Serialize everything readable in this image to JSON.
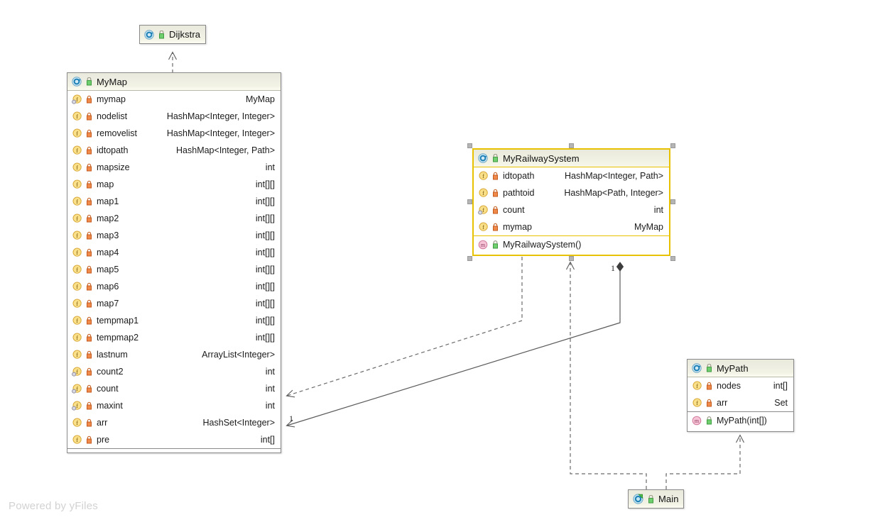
{
  "diagram": {
    "watermark": "Powered by yFiles",
    "classes": [
      {
        "id": "dijkstra",
        "name": "Dijkstra",
        "icon": "class-icon",
        "visibility_icon": "package-visibility-icon",
        "selected": false,
        "fields": [],
        "methods": []
      },
      {
        "id": "mymap",
        "name": "MyMap",
        "icon": "class-icon",
        "visibility_icon": "package-visibility-icon",
        "selected": false,
        "fields": [
          {
            "name": "mymap",
            "type": "MyMap",
            "icon": "field-static-icon",
            "lock": "private-lock-icon"
          },
          {
            "name": "nodelist",
            "type": "HashMap<Integer, Integer>",
            "icon": "field-icon",
            "lock": "private-lock-icon"
          },
          {
            "name": "removelist",
            "type": "HashMap<Integer, Integer>",
            "icon": "field-icon",
            "lock": "private-lock-icon"
          },
          {
            "name": "idtopath",
            "type": "HashMap<Integer, Path>",
            "icon": "field-icon",
            "lock": "private-lock-icon"
          },
          {
            "name": "mapsize",
            "type": "int",
            "icon": "field-icon",
            "lock": "private-lock-icon"
          },
          {
            "name": "map",
            "type": "int[][]",
            "icon": "field-icon",
            "lock": "private-lock-icon"
          },
          {
            "name": "map1",
            "type": "int[][]",
            "icon": "field-icon",
            "lock": "private-lock-icon"
          },
          {
            "name": "map2",
            "type": "int[][]",
            "icon": "field-icon",
            "lock": "private-lock-icon"
          },
          {
            "name": "map3",
            "type": "int[][]",
            "icon": "field-icon",
            "lock": "private-lock-icon"
          },
          {
            "name": "map4",
            "type": "int[][]",
            "icon": "field-icon",
            "lock": "private-lock-icon"
          },
          {
            "name": "map5",
            "type": "int[][]",
            "icon": "field-icon",
            "lock": "private-lock-icon"
          },
          {
            "name": "map6",
            "type": "int[][]",
            "icon": "field-icon",
            "lock": "private-lock-icon"
          },
          {
            "name": "map7",
            "type": "int[][]",
            "icon": "field-icon",
            "lock": "private-lock-icon"
          },
          {
            "name": "tempmap1",
            "type": "int[][]",
            "icon": "field-icon",
            "lock": "private-lock-icon"
          },
          {
            "name": "tempmap2",
            "type": "int[][]",
            "icon": "field-icon",
            "lock": "private-lock-icon"
          },
          {
            "name": "lastnum",
            "type": "ArrayList<Integer>",
            "icon": "field-icon",
            "lock": "private-lock-icon"
          },
          {
            "name": "count2",
            "type": "int",
            "icon": "field-static-icon",
            "lock": "private-lock-icon"
          },
          {
            "name": "count",
            "type": "int",
            "icon": "field-static-icon",
            "lock": "private-lock-icon"
          },
          {
            "name": "maxint",
            "type": "int",
            "icon": "field-static-icon",
            "lock": "private-lock-icon"
          },
          {
            "name": "arr",
            "type": "HashSet<Integer>",
            "icon": "field-icon",
            "lock": "private-lock-icon"
          },
          {
            "name": "pre",
            "type": "int[]",
            "icon": "field-icon",
            "lock": "private-lock-icon"
          }
        ],
        "methods": []
      },
      {
        "id": "myrailwaysystem",
        "name": "MyRailwaySystem",
        "icon": "class-icon",
        "visibility_icon": "package-visibility-icon",
        "selected": true,
        "fields": [
          {
            "name": "idtopath",
            "type": "HashMap<Integer, Path>",
            "icon": "field-icon",
            "lock": "private-lock-icon"
          },
          {
            "name": "pathtoid",
            "type": "HashMap<Path, Integer>",
            "icon": "field-icon",
            "lock": "private-lock-icon"
          },
          {
            "name": "count",
            "type": "int",
            "icon": "field-static-icon",
            "lock": "private-lock-icon"
          },
          {
            "name": "mymap",
            "type": "MyMap",
            "icon": "field-icon",
            "lock": "private-lock-icon"
          }
        ],
        "methods": [
          {
            "name": "MyRailwaySystem()",
            "icon": "method-icon",
            "lock": "package-visibility-icon"
          }
        ]
      },
      {
        "id": "mypath",
        "name": "MyPath",
        "icon": "class-icon",
        "visibility_icon": "package-visibility-icon",
        "selected": false,
        "fields": [
          {
            "name": "nodes",
            "type": "int[]",
            "icon": "field-icon",
            "lock": "private-lock-icon"
          },
          {
            "name": "arr",
            "type": "Set",
            "icon": "field-icon",
            "lock": "private-lock-icon"
          }
        ],
        "methods": [
          {
            "name": "MyPath(int[])",
            "icon": "method-icon",
            "lock": "package-visibility-icon"
          }
        ]
      },
      {
        "id": "main",
        "name": "Main",
        "icon": "main-class-icon",
        "visibility_icon": "package-visibility-icon",
        "selected": false,
        "fields": [],
        "methods": []
      }
    ],
    "edge_labels": [
      {
        "id": "mult-composition",
        "text": "1"
      },
      {
        "id": "mult-association",
        "text": "1"
      }
    ],
    "colors": {
      "selection": "#e8c100",
      "node_border": "#8a8a8a",
      "header_gradient_top": "#e9e9dc",
      "header_gradient_bottom": "#fcfcf3",
      "edge": "#5a5a5a",
      "watermark": "#d2d2d2"
    }
  }
}
